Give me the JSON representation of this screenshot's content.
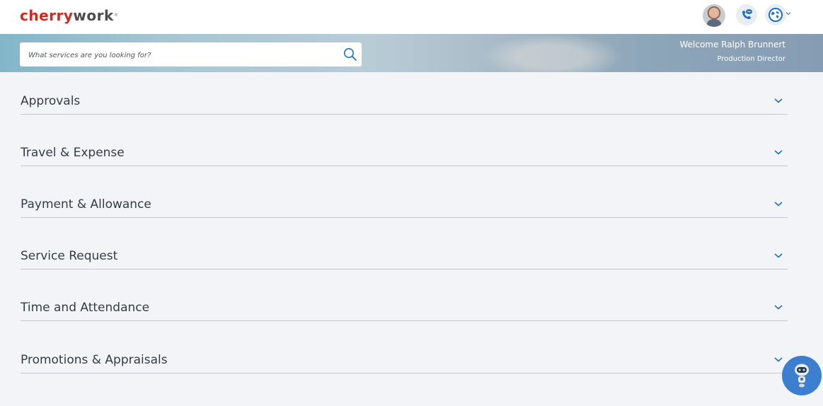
{
  "header": {
    "logo_part1": "cherry",
    "logo_part2": "work",
    "logo_mark": "®",
    "icons": [
      "user-avatar",
      "phone-chat-icon",
      "globe-icon",
      "chevron-down-icon"
    ]
  },
  "search": {
    "placeholder": "What services are you looking for?",
    "value": ""
  },
  "welcome": {
    "greeting": "Welcome Ralph Brunnert",
    "role": "Production Director"
  },
  "sections": [
    {
      "label": "Approvals"
    },
    {
      "label": "Travel & Expense"
    },
    {
      "label": "Payment & Allowance"
    },
    {
      "label": "Service Request"
    },
    {
      "label": "Time and Attendance"
    },
    {
      "label": "Promotions & Appraisals"
    }
  ],
  "colors": {
    "brand_red": "#d02a20",
    "accent_blue": "#3d7fcf",
    "text": "#333c45"
  }
}
